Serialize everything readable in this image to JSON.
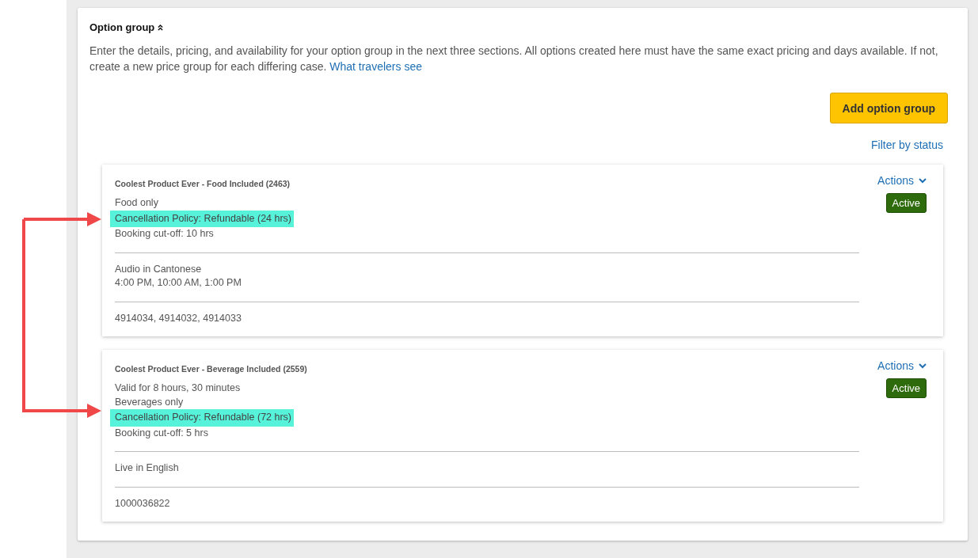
{
  "section": {
    "title": "Option group",
    "expanded": true,
    "description": "Enter the details, pricing, and availability for your option group in the next three sections. All options created here must have the same exact pricing and days available. If not, create a new price group for each differing case.",
    "link": "What travelers see"
  },
  "add_button": "Add option group",
  "filter_link": "Filter by status",
  "option_groups": [
    {
      "title": "Coolest Product Ever - Food Included (2463)",
      "actions": "Actions",
      "status": "Active",
      "sections": [
        [
          {
            "text": "Food only",
            "highlighted": false
          },
          {
            "text": "Cancellation Policy: Refundable (24 hrs)",
            "highlighted": true
          },
          {
            "text": "Booking cut-off: 10 hrs",
            "highlighted": false
          }
        ],
        [
          {
            "text": "Audio in Cantonese",
            "highlighted": false
          },
          {
            "text": "4:00 PM, 10:00 AM, 1:00 PM",
            "highlighted": false
          }
        ],
        [
          {
            "text": "4914034, 4914032, 4914033",
            "highlighted": false
          }
        ]
      ]
    },
    {
      "title": "Coolest Product Ever - Beverage Included (2559)",
      "actions": "Actions",
      "status": "Active",
      "sections": [
        [
          {
            "text": "Valid for 8 hours, 30 minutes",
            "highlighted": false
          },
          {
            "text": "Beverages only",
            "highlighted": false
          },
          {
            "text": "Cancellation Policy: Refundable (72 hrs)",
            "highlighted": true
          },
          {
            "text": "Booking cut-off: 5 hrs",
            "highlighted": false
          }
        ],
        [
          {
            "text": "Live in English",
            "highlighted": false
          }
        ],
        [
          {
            "text": "1000036822",
            "highlighted": false
          }
        ]
      ]
    }
  ]
}
